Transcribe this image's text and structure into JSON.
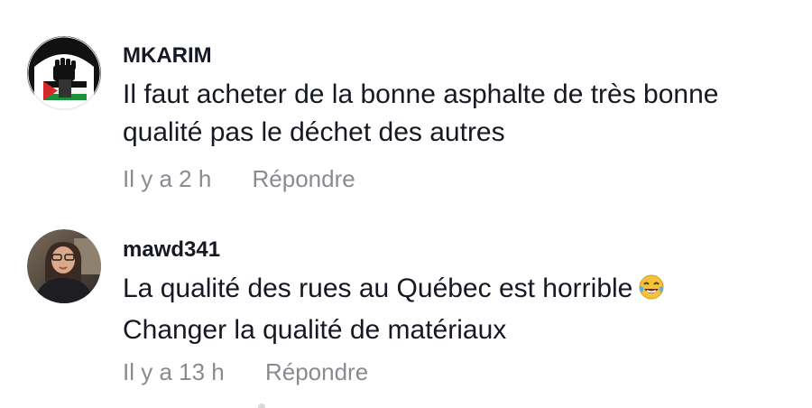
{
  "comments": [
    {
      "username": "MKARIM",
      "avatar_icon": "fist-flag-avatar",
      "text_lines": [
        "Il faut acheter de la bonne asphalte de très bonne",
        "qualité pas le déchet des autres"
      ],
      "time": "Il y a 2 h",
      "reply_label": "Répondre"
    },
    {
      "username": "mawd341",
      "avatar_icon": "profile-photo",
      "text_lines": [
        "La qualité des rues au Québec est horrible",
        "Changer la qualité de matériaux"
      ],
      "emoji": "face-with-tears-of-joy",
      "time": "Il y a 13 h",
      "reply_label": "Répondre"
    }
  ],
  "colors": {
    "text": "#161823",
    "secondary": "#8a8b91",
    "background": "#ffffff"
  }
}
